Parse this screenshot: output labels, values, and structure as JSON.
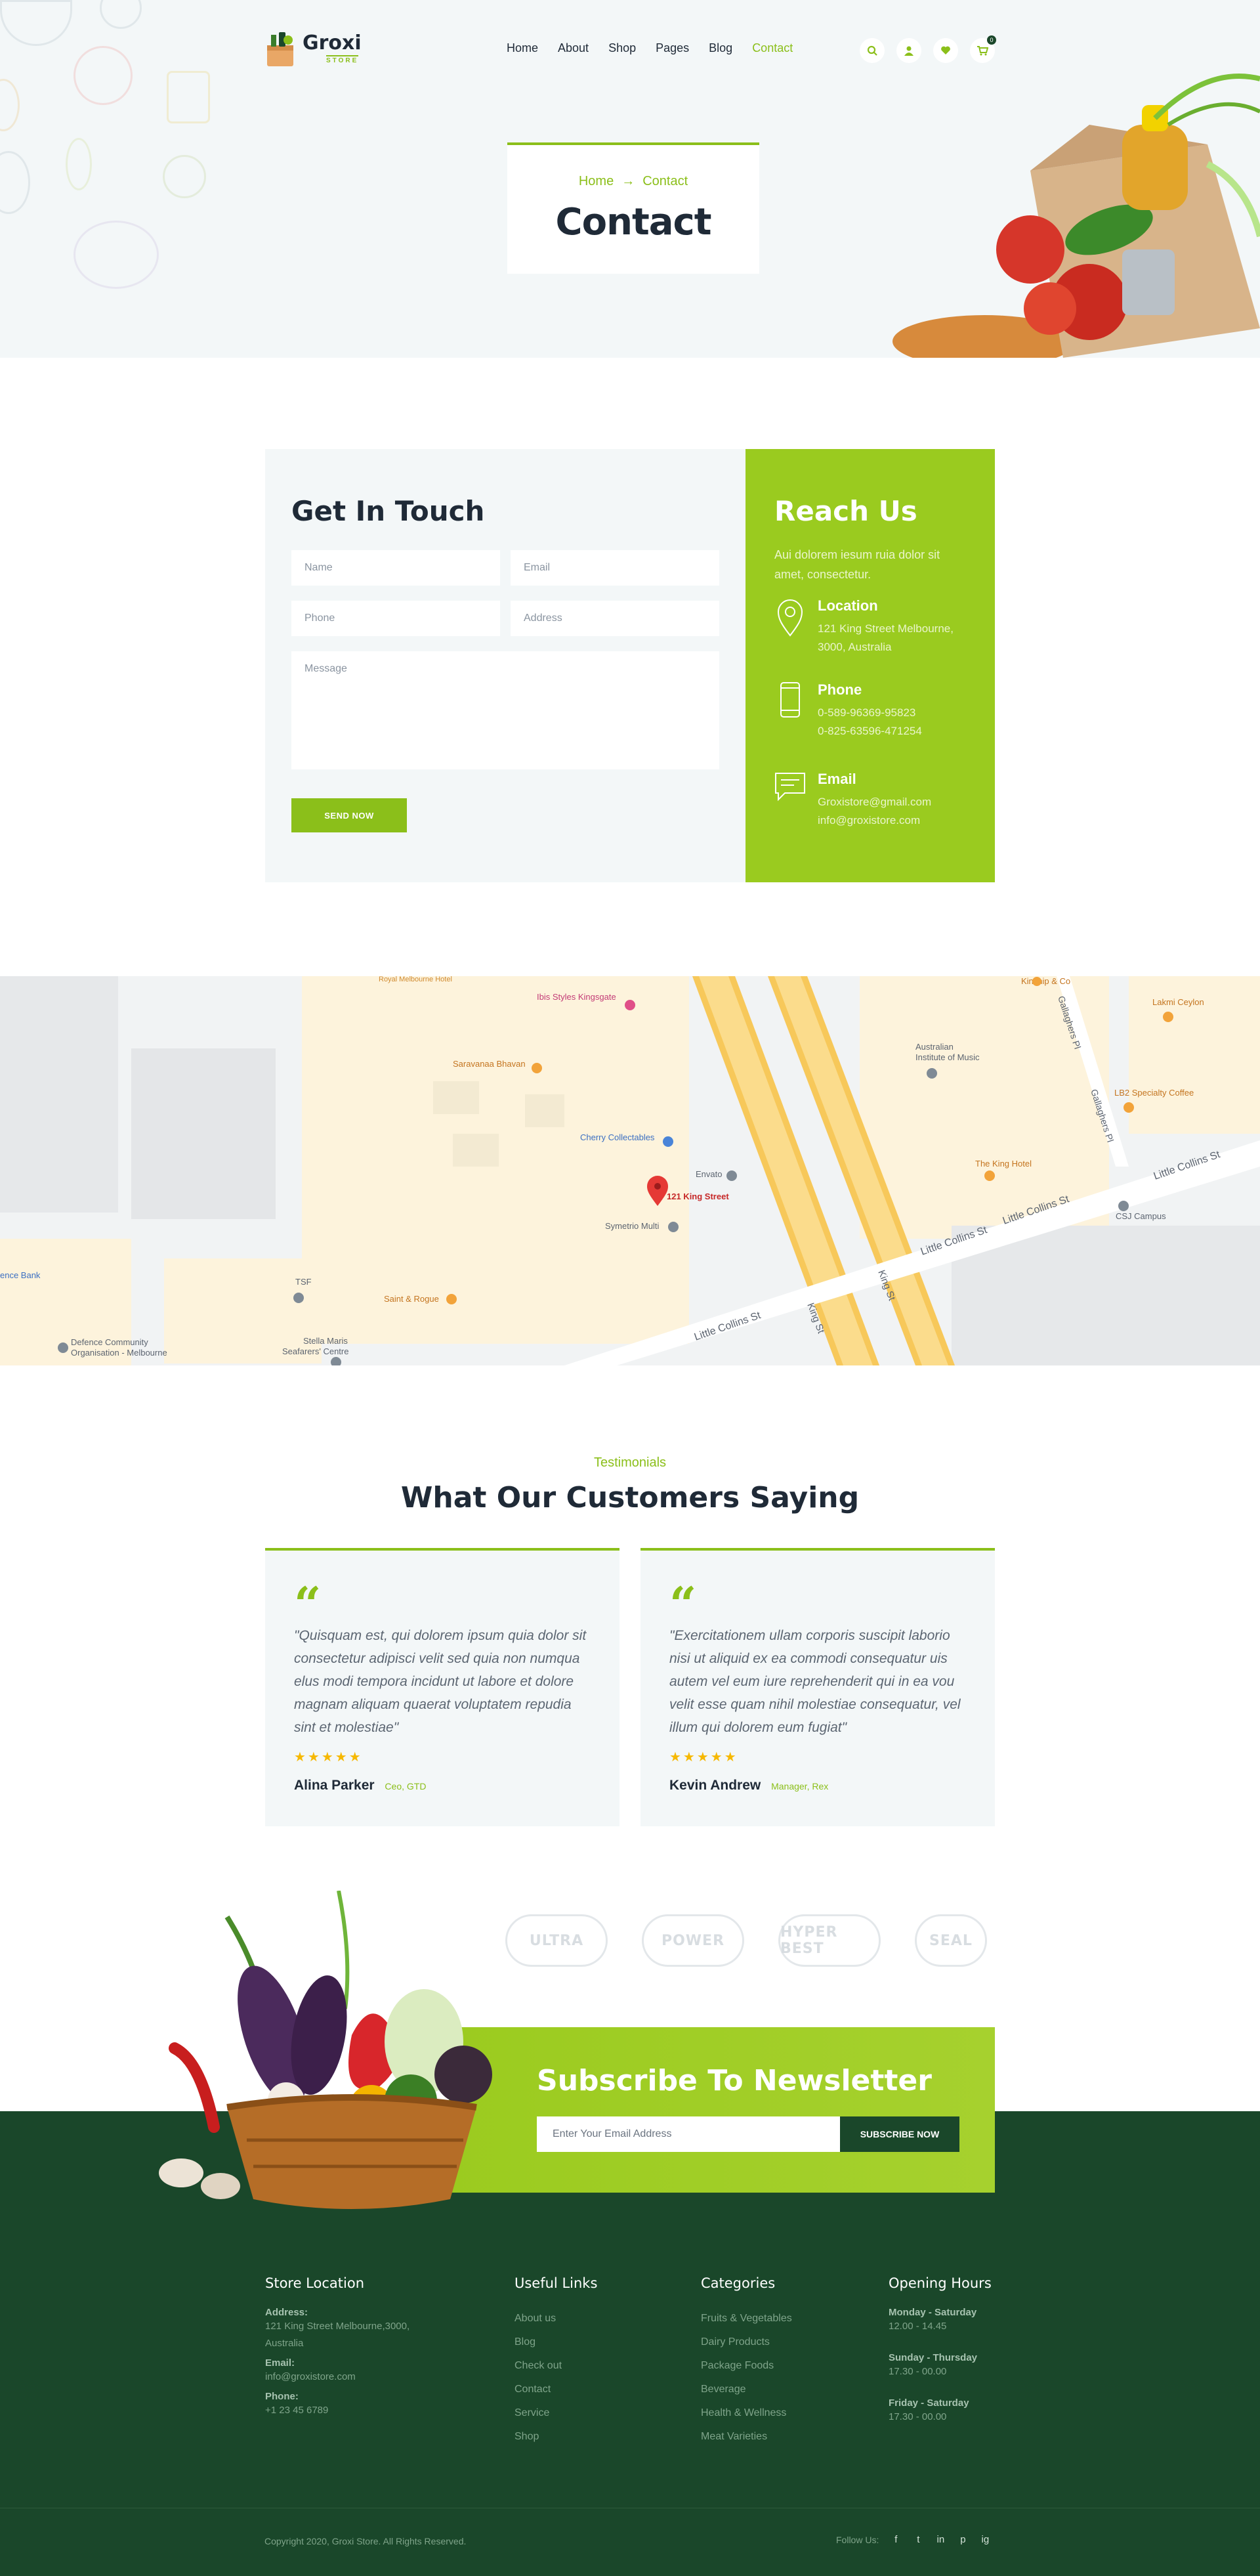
{
  "brand": {
    "name": "Groxi",
    "sub": "STORE"
  },
  "nav": [
    "Home",
    "About",
    "Shop",
    "Pages",
    "Blog",
    "Contact"
  ],
  "cart_count": "0",
  "breadcrumb": {
    "home": "Home",
    "arrow": "→",
    "current": "Contact"
  },
  "page_title": "Contact",
  "form": {
    "title": "Get In Touch",
    "name_ph": "Name",
    "email_ph": "Email",
    "phone_ph": "Phone",
    "address_ph": "Address",
    "message_ph": "Message",
    "send": "SEND NOW"
  },
  "reach": {
    "title": "Reach Us",
    "intro": "Aui dolorem iesum ruia dolor sit amet, consectetur.",
    "location_label": "Location",
    "location_1": "121 King Street Melbourne,",
    "location_2": "3000, Australia",
    "phone_label": "Phone",
    "phone_1": "0-589-96369-95823",
    "phone_2": "0-825-63596-471254",
    "email_label": "Email",
    "email_1": "Groxistore@gmail.com",
    "email_2": "info@groxistore.com"
  },
  "map": {
    "pin_label": "121 King Street",
    "places": [
      "Ibis Styles Kingsgate",
      "Saravanaa Bhavan",
      "Cherry Collectables",
      "Envato",
      "Symetrio Multi",
      "Australian Institute of Music",
      "LB2 Specialty Coffee",
      "The King Hotel",
      "Lakmi Ceylon",
      "Kinship & Co",
      "CSJ Campus",
      "TSF",
      "Saint & Rogue",
      "Stella Maris Seafarers' Centre",
      "Defence Community Organisation - Melbourne",
      "Bank",
      "Royal Melbourne Hotel"
    ],
    "streets": [
      "King St",
      "Little Collins St",
      "Little Collins St",
      "Gallaghers Pl",
      "Little Collins St"
    ]
  },
  "testimonials": {
    "kicker": "Testimonials",
    "title": "What Our Customers Saying",
    "items": [
      {
        "quote": "\"Quisquam est, qui dolorem ipsum quia dolor sit consectetur adipisci velit sed quia non numqua elus modi tempora incidunt ut labore et dolore magnam aliquam quaerat voluptatem repudia sint et molestiae\"",
        "stars": "★★★★★",
        "name": "Alina Parker",
        "role": "Ceo, GTD"
      },
      {
        "quote": "\"Exercitationem ullam corporis suscipit laborio nisi ut aliquid ex ea commodi consequatur uis autem vel eum iure reprehenderit qui in ea vou velit esse quam nihil molestiae consequatur, vel illum qui dolorem eum fugiat\"",
        "stars": "★★★★★",
        "name": "Kevin Andrew",
        "role": "Manager, Rex"
      }
    ]
  },
  "brands": [
    "ULTRA",
    "POWER",
    "HYPER BEST",
    "SEAL"
  ],
  "newsletter": {
    "title": "Subscribe To Newsletter",
    "placeholder": "Enter Your Email Address",
    "button": "SUBSCRIBE NOW"
  },
  "footer": {
    "store": {
      "title": "Store Location",
      "address_label": "Address:",
      "address_1": "121 King Street Melbourne,3000,",
      "address_2": "Australia",
      "email_label": "Email:",
      "email": "info@groxistore.com",
      "phone_label": "Phone:",
      "phone": "+1 23 45 6789"
    },
    "links": {
      "title": "Useful Links",
      "items": [
        "About us",
        "Blog",
        "Check out",
        "Contact",
        "Service",
        "Shop"
      ]
    },
    "categories": {
      "title": "Categories",
      "items": [
        "Fruits & Vegetables",
        "Dairy Products",
        "Package Foods",
        "Beverage",
        "Health & Wellness",
        "Meat Varieties"
      ]
    },
    "hours": {
      "title": "Opening Hours",
      "d1": "Monday - Saturday",
      "t1": "12.00 - 14.45",
      "d2": "Sunday - Thursday",
      "t2": "17.30 - 00.00",
      "d3": "Friday - Saturday",
      "t3": "17.30 - 00.00"
    },
    "copyright": "Copyright 2020, Groxi Store. All Rights Reserved.",
    "follow": "Follow Us:",
    "social": [
      "f",
      "t",
      "in",
      "p",
      "ig"
    ]
  },
  "colors": {
    "accent": "#8bbf1a",
    "dark_green": "#1a472a",
    "text": "#1f2a37",
    "light_bg": "#f3f7f8"
  }
}
